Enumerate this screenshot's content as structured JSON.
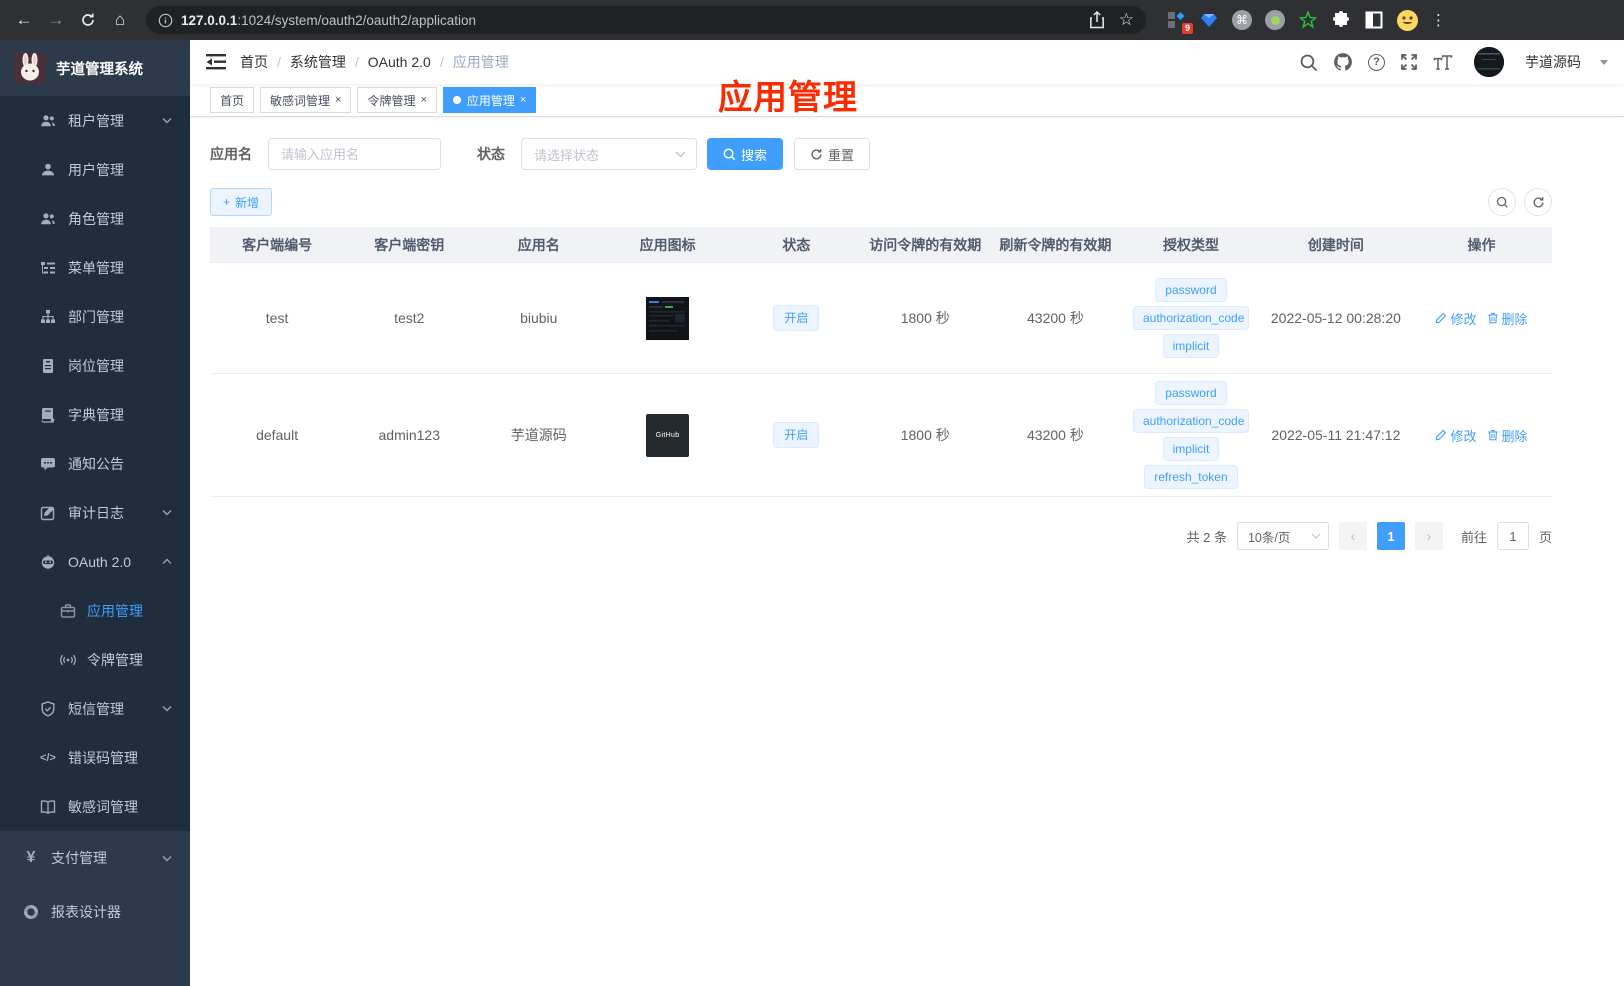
{
  "colors": {
    "accent": "#409eff",
    "annotation_red": "#fb2b01",
    "sidebar_dark": "#1f2d3d",
    "sidebar_light": "#2d3a4b"
  },
  "icons": {
    "back": "←",
    "forward": "→",
    "home": "⌂",
    "star": "☆",
    "more": "⋮",
    "help": "?",
    "close": "×",
    "plus": "+",
    "code": "</>",
    "yen": "¥",
    "cmd": "⌘",
    "prev": "‹",
    "next": "›"
  },
  "browser": {
    "url_host": "127.0.0.1",
    "url_rest": ":1024/system/oauth2/oauth2/application",
    "ext_badge": "9"
  },
  "sidebar": {
    "title": "芋道管理系统",
    "menu": [
      {
        "label": "租户管理",
        "arrow": true
      },
      {
        "label": "用户管理"
      },
      {
        "label": "角色管理"
      },
      {
        "label": "菜单管理"
      },
      {
        "label": "部门管理"
      },
      {
        "label": "岗位管理"
      },
      {
        "label": "字典管理"
      },
      {
        "label": "通知公告"
      },
      {
        "label": "审计日志",
        "arrow": true
      },
      {
        "label": "OAuth 2.0",
        "arrow": true,
        "expanded": true,
        "children": [
          {
            "label": "应用管理",
            "active": true
          },
          {
            "label": "令牌管理"
          }
        ]
      },
      {
        "label": "短信管理",
        "arrow": true
      },
      {
        "label": "错误码管理"
      },
      {
        "label": "敏感词管理"
      }
    ],
    "bottom": [
      {
        "label": "支付管理",
        "arrow": true
      },
      {
        "label": "报表设计器"
      }
    ]
  },
  "header": {
    "breadcrumb": [
      "首页",
      "系统管理",
      "OAuth 2.0",
      "应用管理"
    ],
    "separator": "/",
    "user": "芋道源码"
  },
  "tabs": [
    {
      "label": "首页",
      "closable": false
    },
    {
      "label": "敏感词管理",
      "closable": true
    },
    {
      "label": "令牌管理",
      "closable": true
    },
    {
      "label": "应用管理",
      "closable": true,
      "active": true
    }
  ],
  "annotation": {
    "text": "应用管理"
  },
  "filters": {
    "name_label": "应用名",
    "name_placeholder": "请输入应用名",
    "status_label": "状态",
    "status_placeholder": "请选择状态",
    "search": "搜索",
    "reset": "重置"
  },
  "toolbar": {
    "add": "新增"
  },
  "table": {
    "headers": [
      "客户端编号",
      "客户端密钥",
      "应用名",
      "应用图标",
      "状态",
      "访问令牌的有效期",
      "刷新令牌的有效期",
      "授权类型",
      "创建时间",
      "操作"
    ],
    "rows": [
      {
        "client_id": "test",
        "secret": "test2",
        "name": "biubiu",
        "status": "开启",
        "access_ttl": "1800 秒",
        "refresh_ttl": "43200 秒",
        "grants": [
          "password",
          "authorization_code",
          "implicit"
        ],
        "created": "2022-05-12 00:28:20"
      },
      {
        "client_id": "default",
        "secret": "admin123",
        "name": "芋道源码",
        "icon_text": "GitHub",
        "status": "开启",
        "access_ttl": "1800 秒",
        "refresh_ttl": "43200 秒",
        "grants": [
          "password",
          "authorization_code",
          "implicit",
          "refresh_token"
        ],
        "created": "2022-05-11 21:47:12"
      }
    ],
    "edit": "修改",
    "delete": "删除"
  },
  "pagination": {
    "total": "共 2 条",
    "page_size": "10条/页",
    "page": "1",
    "goto": "前往",
    "goto_value": "1",
    "unit": "页"
  }
}
